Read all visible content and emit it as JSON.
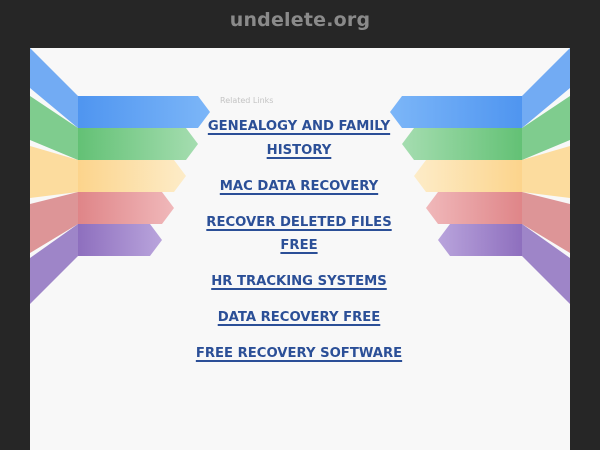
{
  "header": {
    "domain": "undelete.org"
  },
  "related": {
    "label": "Related Links",
    "links": [
      "GENEALOGY AND FAMILY HISTORY",
      "MAC DATA RECOVERY",
      "RECOVER DELETED FILES FREE",
      "HR TRACKING SYSTEMS",
      "DATA RECOVERY FREE",
      "FREE RECOVERY SOFTWARE"
    ]
  },
  "colors": {
    "background": "#262626",
    "panel": "#f8f8f8",
    "link": "#2b4f97",
    "ribbon_blue": "#6aa9f5",
    "ribbon_green": "#7fcf8c",
    "ribbon_yellow": "#fde0a6",
    "ribbon_red": "#e59c9e",
    "ribbon_purple": "#9f84c8"
  }
}
